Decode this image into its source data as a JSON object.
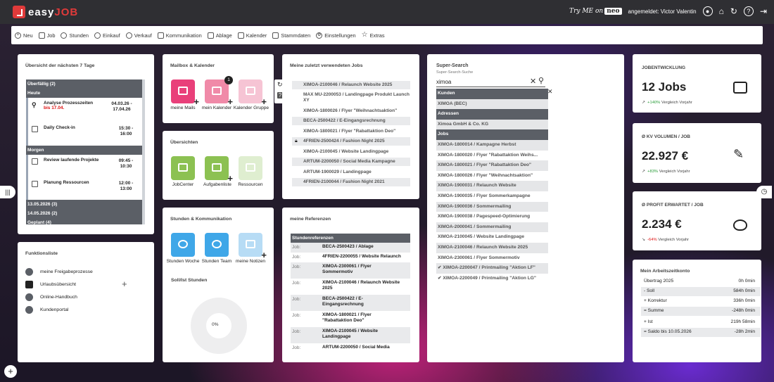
{
  "app": {
    "name_a": "easy",
    "name_b": "JOB"
  },
  "topbar": {
    "neo_try": "Try ME",
    "neo_on": "on",
    "neo_badge": "neo",
    "user": "angemeldet: Victor Valentin"
  },
  "menu": [
    {
      "label": "Neu",
      "icon": "plus-circle-icon"
    },
    {
      "label": "Job",
      "icon": "folder-icon"
    },
    {
      "label": "Stunden",
      "icon": "clock-icon"
    },
    {
      "label": "Einkauf",
      "icon": "cart-icon"
    },
    {
      "label": "Verkauf",
      "icon": "sale-icon"
    },
    {
      "label": "Kommunikation",
      "icon": "chat-icon"
    },
    {
      "label": "Ablage",
      "icon": "folder-icon"
    },
    {
      "label": "Kalender",
      "icon": "calendar-icon"
    },
    {
      "label": "Stammdaten",
      "icon": "data-icon"
    },
    {
      "label": "Einstellungen",
      "icon": "gear-icon"
    },
    {
      "label": "Extras",
      "icon": "star-icon"
    }
  ],
  "overview": {
    "title": "Übersicht der nächsten 7 Tage",
    "sec_overdue": "Überfällig (2)",
    "sec_today": "Heute",
    "items_today": [
      {
        "title": "Analyse Prozesszeiten",
        "sub": "bis 17.04.",
        "time": "04.03.26 - 17.04.26"
      },
      {
        "title": "Daily Check-in",
        "sub": "",
        "time": "15:30 - 16:00"
      }
    ],
    "sec_tomorrow": "Morgen",
    "items_tomorrow": [
      {
        "title": "Review laufende Projekte",
        "time": "09:45 - 10:30"
      },
      {
        "title": "Planung Ressourcen",
        "time": "12:00 - 13:00"
      }
    ],
    "sec_d1": "13.05.2026 (3)",
    "sec_d2": "14.05.2026 (2)",
    "sec_d3": "Geplant (4)"
  },
  "mailbox": {
    "title": "Mailbox & Kalender",
    "tiles": [
      {
        "label": "meine Mails"
      },
      {
        "label": "mein Kalender",
        "badge": "1"
      },
      {
        "label": "Kalender Gruppe"
      }
    ]
  },
  "uebersichten": {
    "title": "Übersichten",
    "tiles": [
      {
        "label": "JobCenter"
      },
      {
        "label": "Aufgabenliste"
      },
      {
        "label": "Ressourcen"
      }
    ]
  },
  "stunden": {
    "title": "Stunden & Kommunikation",
    "tiles": [
      {
        "label": "Stunden Woche"
      },
      {
        "label": "Stunden Team"
      },
      {
        "label": "meine Notizen"
      }
    ],
    "sollist": "Soll/Ist Stunden",
    "donut_pct": "0%"
  },
  "funktionsliste": {
    "title": "Funktionsliste",
    "items": [
      "meine Freigabeprozesse",
      "Urlaubsübersicht",
      "Online-Handbuch",
      "Kundenportal"
    ]
  },
  "recent": {
    "title": "Meine zuletzt verwendeten Jobs",
    "items": [
      "XIMOA-2100046 / Relaunch Website 2025",
      "MAX MU-2200053 / Landingpage Produkt Launch XY",
      "XIMOA-1800026 / Flyer \"Weihnachtsaktion\"",
      "BECA-2500422 / E-Eingangsrechnung",
      "XIMOA-1800021 / Flyer \"Rabattaktion Deo\"",
      "4FRIEN-2500424 / Fashion Night 2025",
      "XIMOA-2100045 / Website Landingpage",
      "ARTUM-2200050 / Social Media Kampagne",
      "ARTUM-1900029 / Landingpage",
      "4FRIEN-2100044 / Fashion Night 2021"
    ]
  },
  "refs": {
    "title": "meine Referenzen",
    "head": "Stundenreferenzen",
    "label": "Job:",
    "items": [
      "BECA-2500423 / Ablage",
      "4FRIEN-2200055 / Website Relaunch",
      "XIMOA-2300061 / Flyer Sommermotiv",
      "XIMOA-2100046 / Relaunch Website 2025",
      "BECA-2500422 / E-Eingangsrechnung",
      "XIMOA-1800021 / Flyer \"Rabattaktion Deo\"",
      "XIMOA-2100045 / Website Landingpage",
      "ARTUM-2200050 / Social Media"
    ]
  },
  "search": {
    "title": "Super-Search",
    "subtitle": "Super-Search-Suche",
    "query": "ximoa",
    "kunden_head": "Kunden",
    "kunden": [
      "XIMOA (BEC)"
    ],
    "adressen_head": "Adressen",
    "adressen": [
      "Ximoa GmbH & Co. KG"
    ],
    "jobs_head": "Jobs",
    "jobs": [
      "XIMOA-1800014 / Kampagne Herbst",
      "XIMOA-1800020 / Flyer \"Rabattaktion Weihs...",
      "XIMOA-1800021 / Flyer \"Rabattaktion Deo\"",
      "XIMOA-1800026 / Flyer \"Weihnachtsaktion\"",
      "XIMOA-1900031 / Relaunch Website",
      "XIMOA-1900035 / Flyer Sommerkampagne",
      "XIMOA-1900036 / Sommermailing",
      "XIMOA-1900038 / Pagespeed-Optimierung",
      "XIMOA-2000041 / Sommermailing",
      "XIMOA-2100045 / Website Landingpage",
      "XIMOA-2100046 / Relaunch Website 2025",
      "XIMOA-2300061 / Flyer Sommermotiv",
      "✔ XIMOA-2200047 / Printmailing \"Aktion LF\"",
      "✔ XIMOA-2200049 / Printmailing \"Aktion LG\""
    ]
  },
  "kpi": [
    {
      "title": "JOBENTWICKLUNG",
      "value": "12 Jobs",
      "delta": "+140%",
      "sub": "Vergleich Vorjahr",
      "dir": "up"
    },
    {
      "title": "Ø KV VOLUMEN / JOB",
      "value": "22.927 €",
      "delta": "+83%",
      "sub": "Vergleich Vorjahr",
      "dir": "up"
    },
    {
      "title": "Ø PROFIT ERWARTET / JOB",
      "value": "2.234 €",
      "delta": "-64%",
      "sub": "Vergleich Vorjahr",
      "dir": "down"
    }
  ],
  "arbeitszeit": {
    "title": "Mein Arbeitszeitkonto",
    "rows": [
      {
        "label": "Übertrag 2025",
        "value": "0h 0min"
      },
      {
        "label": "-  Soll",
        "value": "584h 0min"
      },
      {
        "label": "+  Korrektur",
        "value": "336h 0min"
      },
      {
        "label": "=  Summe",
        "value": "-248h 0min"
      },
      {
        "label": "+  Ist",
        "value": "219h 58min"
      },
      {
        "label": "=  Saldo bis 10.05.2026",
        "value": "-28h 2min"
      }
    ]
  },
  "colors": {
    "mail": "#e9407a",
    "cal": "#f08aa8",
    "group": "#f6c4d4",
    "green": "#8cc152",
    "green_light": "#dfeed0",
    "blue": "#3fa7e8",
    "blue_light": "#b7dcf5"
  }
}
